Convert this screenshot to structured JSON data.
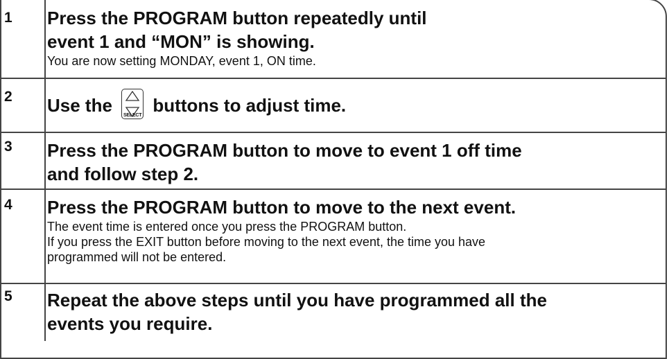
{
  "steps": [
    {
      "number": "1",
      "heading_lines": [
        "Press the PROGRAM button repeatedly until",
        "event 1 and “MON” is showing."
      ],
      "notes": [
        "You are now setting MONDAY, event 1, ON time."
      ]
    },
    {
      "number": "2",
      "heading_before": "Use the",
      "heading_after": "buttons to adjust time.",
      "button_label": "SELECT",
      "button_icons": [
        "triangle-up-icon",
        "triangle-down-icon"
      ]
    },
    {
      "number": "3",
      "heading_lines": [
        "Press the PROGRAM button to move to event 1 off time",
        "and follow step 2."
      ],
      "notes": []
    },
    {
      "number": "4",
      "heading_lines": [
        "Press the PROGRAM button to move to the next event."
      ],
      "notes": [
        "The event time is entered once you press the PROGRAM button.",
        "If you press the EXIT button before moving to the next event, the time you have",
        "programmed will not be entered."
      ]
    },
    {
      "number": "5",
      "heading_lines": [
        "Repeat the above steps until you have programmed all the",
        "events you require."
      ],
      "notes": []
    }
  ],
  "colors": {
    "border": "#444444",
    "text": "#111111"
  }
}
